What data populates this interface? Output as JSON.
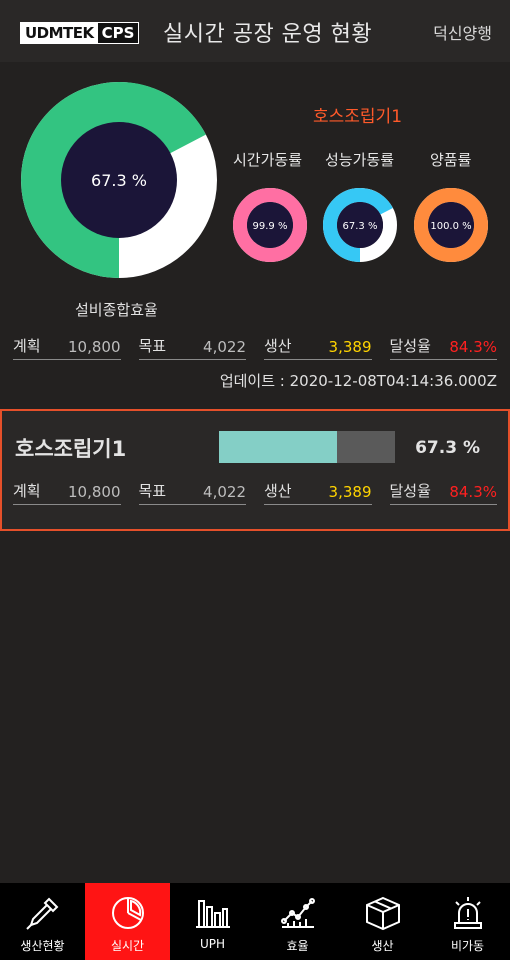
{
  "header": {
    "logo_left": "UDMTEK",
    "logo_right": "CPS",
    "title": "실시간 공장 운영 현황",
    "company": "덕신양행"
  },
  "summary": {
    "oee_value": "67.3 %",
    "oee_fraction": 0.673,
    "oee_label": "설비종합효율",
    "machine_title": "호스조립기1",
    "minis": [
      {
        "label": "시간가동률",
        "value": "99.9 %",
        "fraction": 0.999,
        "color": "#ff6fa3"
      },
      {
        "label": "성능가동률",
        "value": "67.3 %",
        "fraction": 0.673,
        "color": "#36c8f5"
      },
      {
        "label": "양품률",
        "value": "100.0 %",
        "fraction": 1.0,
        "color": "#ff8b3d"
      }
    ],
    "stats": {
      "plan_label": "계획",
      "plan_value": "10,800",
      "target_label": "목표",
      "target_value": "4,022",
      "prod_label": "생산",
      "prod_value": "3,389",
      "rate_label": "달성율",
      "rate_value": "84.3%"
    },
    "update_text": "업데이트 : 2020-12-08T04:14:36.000Z"
  },
  "card": {
    "name": "호스조립기1",
    "progress_fraction": 0.673,
    "percent": "67.3 %",
    "stats": {
      "plan_label": "계획",
      "plan_value": "10,800",
      "target_label": "목표",
      "target_value": "4,022",
      "prod_label": "생산",
      "prod_value": "3,389",
      "rate_label": "달성율",
      "rate_value": "84.3%"
    }
  },
  "nav": [
    {
      "label": "생산현황",
      "icon": "pen-tool-icon"
    },
    {
      "label": "실시간",
      "icon": "pie-chart-icon"
    },
    {
      "label": "UPH",
      "icon": "bar-chart-icon"
    },
    {
      "label": "효율",
      "icon": "line-chart-icon"
    },
    {
      "label": "생산",
      "icon": "box-icon"
    },
    {
      "label": "비가동",
      "icon": "alarm-icon"
    }
  ],
  "colors": {
    "oee_fill": "#33c481",
    "oee_rest": "#ffffff",
    "donut_center": "#1b1538",
    "accent": "#e5502a",
    "active_nav": "#ff1414"
  }
}
